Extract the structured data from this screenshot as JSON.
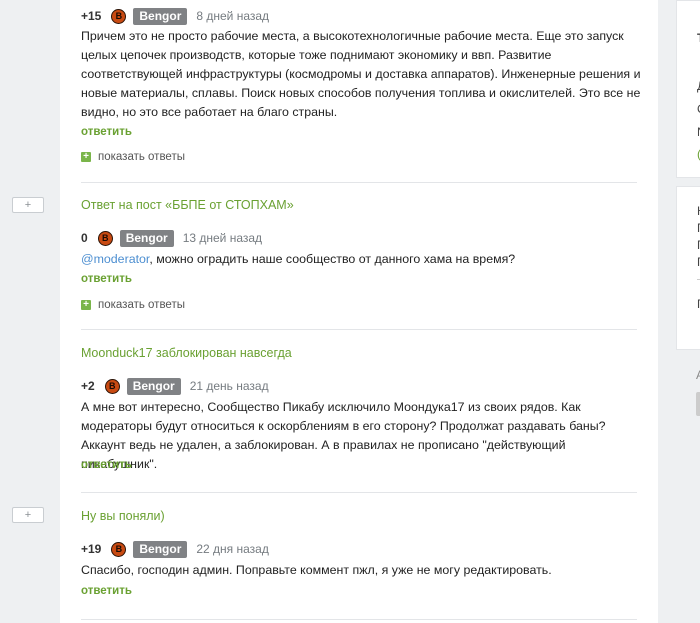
{
  "comments": [
    {
      "rating": "+15",
      "avatar_letter": "B",
      "author": "Bengor",
      "time": "8 дней назад",
      "text": "Причем это не просто рабочие места, а высокотехнологичные рабочие места. Еще это запуск целых цепочек производств, которые тоже поднимают экономику и ввп. Развитие соответствующей инфраструктуры (космодромы и доставка аппаратов). Инженерные решения и новые материалы, сплавы. Поиск новых способов получения топлива и окислителей. Это все не видно, но это все работает на благо страны.",
      "reply_label": "ответить",
      "show_replies_label": "показать ответы"
    },
    {
      "thread_title": "Ответ на пост «ББПЕ от СТОПХАМ»",
      "rating": "0",
      "avatar_letter": "B",
      "author": "Bengor",
      "time": "13 дней назад",
      "mention": "@moderator",
      "text": ", можно оградить наше сообщество от данного хама на время?",
      "reply_label": "ответить",
      "show_replies_label": "показать ответы"
    },
    {
      "thread_title": "Moonduck17 заблокирован навсегда",
      "rating": "+2",
      "avatar_letter": "B",
      "author": "Bengor",
      "time": "21 день назад",
      "text": "А мне вот интересно, Сообщество Пикабу исключило Моондука17 из своих рядов. Как модераторы будут относиться к оскорблениям в его сторону? Продолжат раздавать баны? Аккаунт ведь не удален, а заблокирован. А в правилах не прописано \"действующий пикабушник\".",
      "reply_label": "ответить"
    },
    {
      "thread_title": "Ну вы поняли)",
      "rating": "+19",
      "avatar_letter": "B",
      "author": "Bengor",
      "time": "22 дня назад",
      "text": "Спасибо, господин админ. Поправьте коммент пжл, я уже не могу редактировать.",
      "reply_label": "ответить"
    }
  ],
  "expand_button": "+",
  "sidebar_fragments": [
    "Т",
    "Д",
    "С",
    "N",
    "(",
    "Н",
    "П",
    "П",
    "П",
    "П",
    "А"
  ],
  "colors": {
    "link_green": "#6aa132",
    "mention_blue": "#4d8fd1",
    "nick_bg": "#808285",
    "avatar": "#c84a12"
  }
}
